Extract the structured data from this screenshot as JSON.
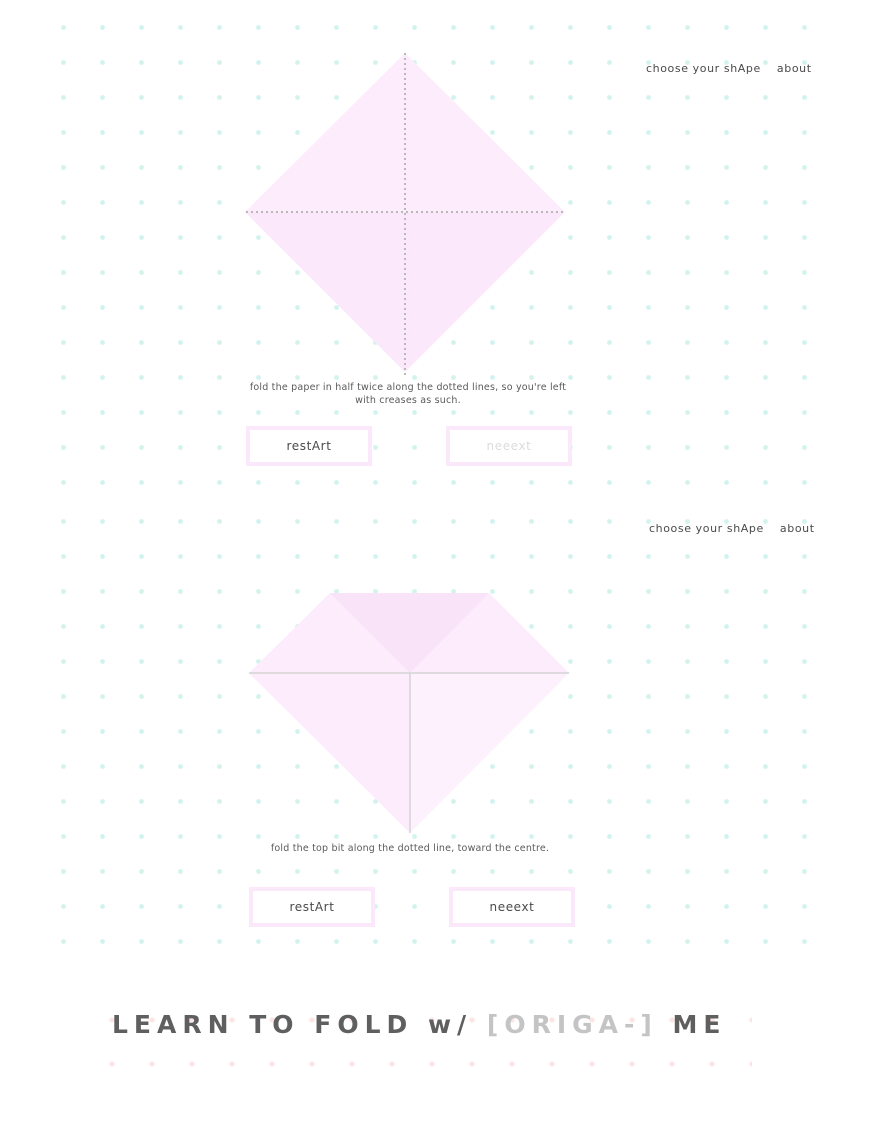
{
  "panels": [
    {
      "nav": {
        "choose": "choose your shApe",
        "about": "about"
      },
      "caption": "fold the paper in half twice along the dotted lines, so you're left with creases as such.",
      "buttons": {
        "restart": "restArt",
        "next": "neeext"
      },
      "next_enabled": false
    },
    {
      "nav": {
        "choose": "choose your shApe",
        "about": "about"
      },
      "caption": "fold the top bit along the dotted line, toward the centre.",
      "buttons": {
        "restart": "restArt",
        "next": "neeext"
      },
      "next_enabled": true
    }
  ],
  "footer": {
    "prefix": "LEARN TO FOLD w/ ",
    "brand": "[ORIGA-]",
    "suffix": " ME"
  },
  "colors": {
    "paper": "#fcecfc",
    "paper_dark": "#f8e3f8",
    "dot_grid": "#d3f3ee",
    "crease": "#b9b9b9",
    "button_border": "#fbe8fb",
    "footer_dot": "#fde5e5"
  }
}
